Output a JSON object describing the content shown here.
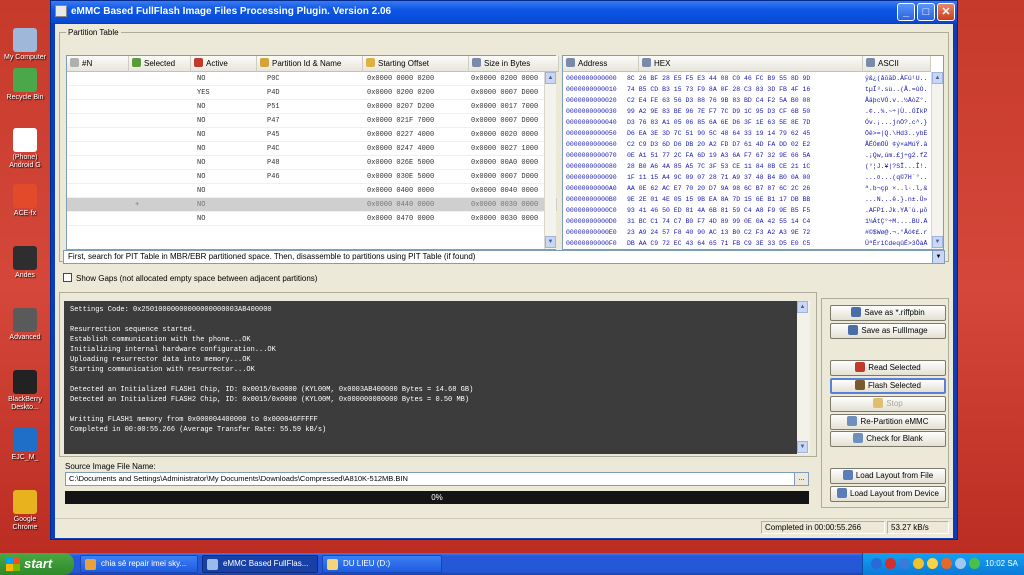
{
  "desktop": {
    "icons": [
      {
        "label": "My Computer",
        "color": "#9fb7d9"
      },
      {
        "label": "Recycle Bin",
        "color": "#4aa84a"
      },
      {
        "label": "(Phone) Android G",
        "color": "#ffffff"
      },
      {
        "label": "ACE-fx",
        "color": "#e24a2a"
      },
      {
        "label": "Andes",
        "color": "#2e2e2e"
      },
      {
        "label": "Advanced",
        "color": "#5a5a5a"
      },
      {
        "label": "BlackBerry Deskto...",
        "color": "#222222"
      },
      {
        "label": "EJC_M_",
        "color": "#1f6fc9"
      },
      {
        "label": "Google Chrome",
        "color": "#e8b21f"
      }
    ]
  },
  "window": {
    "title": "eMMC Based FullFlash Image Files Processing Plugin. Version 2.06",
    "minimize": "_",
    "maximize": "□",
    "close": "✕"
  },
  "partition_table": {
    "label": "Partition Table",
    "columns": [
      "#N",
      "Selected",
      "Active",
      "Partition Id & Name",
      "Starting Offset",
      "Size in Bytes"
    ],
    "rows": [
      {
        "n": "",
        "selected": "",
        "active": "NO",
        "name": "P0C",
        "offset": "0x0000 0000 0200",
        "size": "0x0000 0200 0000"
      },
      {
        "n": "",
        "selected": "",
        "active": "YES",
        "name": "P4D",
        "offset": "0x0000 0200 0200",
        "size": "0x0000 0007 D000"
      },
      {
        "n": "",
        "selected": "",
        "active": "NO",
        "name": "P51",
        "offset": "0x0000 0207 D200",
        "size": "0x0000 0017 7000"
      },
      {
        "n": "",
        "selected": "",
        "active": "NO",
        "name": "P47",
        "offset": "0x0000 021F 7000",
        "size": "0x0000 0007 D000"
      },
      {
        "n": "",
        "selected": "",
        "active": "NO",
        "name": "P45",
        "offset": "0x0000 0227 4000",
        "size": "0x0000 0020 0000"
      },
      {
        "n": "",
        "selected": "",
        "active": "NO",
        "name": "P4C",
        "offset": "0x0000 0247 4000",
        "size": "0x0000 0027 1000"
      },
      {
        "n": "",
        "selected": "",
        "active": "NO",
        "name": "P48",
        "offset": "0x0000 026E 5000",
        "size": "0x0000 00A0 0000"
      },
      {
        "n": "",
        "selected": "",
        "active": "NO",
        "name": "P46",
        "offset": "0x0000 030E 5000",
        "size": "0x0000 0007 D000"
      },
      {
        "n": "",
        "selected": "",
        "active": "NO",
        "name": "",
        "offset": "0x0000 0400 0000",
        "size": "0x0000 0040 0000"
      },
      {
        "n": "",
        "selected": "+",
        "active": "NO",
        "name": "",
        "offset": "0x0000 0440 0000",
        "size": "0x0000 0030 0000"
      },
      {
        "n": "",
        "selected": "",
        "active": "NO",
        "name": "",
        "offset": "0x0000 0470 0000",
        "size": "0x0000 0030 0000"
      }
    ],
    "selected_index": 9
  },
  "hex_view": {
    "columns": [
      "Address",
      "HEX",
      "ASCII"
    ],
    "rows": [
      {
        "addr": "0000000000000",
        "hex": "8C 26 BF 28 E5 F5 E3 44 08 C0 46 FC B9 55 8D 9D",
        "ascii": "ÿ&¿(åõãD.ÀFü¹U.."
      },
      {
        "addr": "0000000000010",
        "hex": "74 B5 CD B3 15 73 F9 8A 0F 28 C3 83 3D FB 4F 16",
        "ascii": "tµÍ³.sù..(Ã.=ûO."
      },
      {
        "addr": "0000000000020",
        "hex": "C2 E4 FE 63 56 D3 88 76 9B 83 BD C4 F2 5A B0 08",
        "ascii": "ÂäþcVÓ.v..½ÄòZ°."
      },
      {
        "addr": "0000000000030",
        "hex": "99 A2 9E 83 BE 96 7E F7 7C D9 1C 95 D3 CF 6B 50",
        "ascii": ".¢..¾.~÷|Ù..ÓÏkP"
      },
      {
        "addr": "0000000000040",
        "hex": "D3 76 83 A1 05 06 85 6A 6E D6 3F 1E 63 5E 8E 7D",
        "ascii": "Óv.¡...jnÖ?.c^.}"
      },
      {
        "addr": "0000000000050",
        "hex": "D6 EA 3E 3D 7C 51 90 5C 48 64 33 19 14 79 62 45",
        "ascii": "Öê>=|Q.\\Hd3..ybE"
      },
      {
        "addr": "0000000000060",
        "hex": "C2 C9 D3 6D D6 DB 20 A2 FD D7 61 4D FA DD 02 E2",
        "ascii": "ÂÉÓmÖÛ ¢ý×aMúÝ.â"
      },
      {
        "addr": "0000000000070",
        "hex": "0E A1 51 77 2C FA 6D 19 A3 6A F7 67 32 9E 66 5A",
        "ascii": ".¡Qw,úm.£j÷g2.fZ"
      },
      {
        "addr": "0000000000080",
        "hex": "28 B0 A6 4A 85 A5 7C 3F 53 CE 11 84 8B CE 21 1C",
        "ascii": "(°¦J.¥|?SÎ...Î!."
      },
      {
        "addr": "0000000000090",
        "hex": "1F 11 15 A4 9C 09 07 28 71 A9 37 48 B4 B0 0A 00",
        "ascii": "...¤...(q©7H´°.."
      },
      {
        "addr": "00000000000A0",
        "hex": "AA 0E 62 AC E7 70 20 D7 9A 98 6C B7 87 6C 2C 26",
        "ascii": "ª.b¬çp ×..l·.l,&"
      },
      {
        "addr": "00000000000B0",
        "hex": "9E 2E 01 4E 05 15 9B EA 8A 7D 15 6E B1 17 DB BB",
        "ascii": "...N...ê.}.n±.Û»"
      },
      {
        "addr": "00000000000C0",
        "hex": "93 41 46 50 ED 81 4A 6B 81 59 C4 A8 F9 9E B5 F5",
        "ascii": ".AFPí.Jk.YÄ¨ù.µõ"
      },
      {
        "addr": "00000000000D0",
        "hex": "31 BC C1 74 C7 B0 F7 4D 89 99 0E 0A 42 55 14 C4",
        "ascii": "1¼ÁtÇ°÷M....BU.Ä"
      },
      {
        "addr": "00000000000E0",
        "hex": "23 A9 24 57 F8 40 90 AC 13 B0 C2 F3 A2 A3 9E 72",
        "ascii": "#©$Wø@.¬.°Âó¢£.r"
      },
      {
        "addr": "00000000000F0",
        "hex": "DB AA C9 72 EC 43 64 65 71 FB C9 3E 33 D5 E0 C5",
        "ascii": "ÛªÉrìCdeqûÉ>3ÕàÅ"
      }
    ]
  },
  "pit_mode": "First, search for PIT Table in MBR/EBR partitioned space. Then, disassemble to partitions using PIT Table (if found)",
  "show_gaps_label": "Show Gaps (not allocated empty space between adjacent partitions)",
  "log_lines": [
    "Settings Code: 0x25010000000000000000003AB400000",
    "",
    "Resurrection sequence started.",
    "Establish communication with the phone...OK",
    "Initializing internal hardware configuration...OK",
    "Uploading resurrector data into memory...OK",
    "Starting communication with resurrector...OK",
    "",
    "Detected an Initialized FLASH1 Chip, ID: 0x0015/0x0000 (KYL00M, 0x0003AB400000 Bytes = 14.68 GB)",
    "Detected an Initialized FLASH2 Chip, ID: 0x0015/0x0000 (KYL00M, 0x000000080000 Bytes = 0.50 MB)",
    "",
    "Writting FLASH1 memory from 0x000004400000 to 0x000046FFFFF",
    "Completed in 00:00:55.266 (Average Transfer Rate: 55.59 kB/s)"
  ],
  "buttons": {
    "save_riff": "Save as *.riffpbin",
    "save_full": "Save as FullImage",
    "read_selected": "Read Selected",
    "flash_selected": "Flash Selected",
    "stop": "Stop",
    "repartition": "Re-Partition eMMC",
    "check_blank": "Check for Blank",
    "load_file": "Load Layout from File",
    "load_device": "Load Layout from Device"
  },
  "source": {
    "label": "Source Image File Name:",
    "path": "C:\\Documents and Settings\\Administrator\\My Documents\\Downloads\\Compressed\\A810K-512MB.BIN",
    "browse": "..."
  },
  "progress": {
    "text": "0%",
    "value": 0
  },
  "status": {
    "completed": "Completed in 00:00:55.266",
    "rate": "53.27 kB/s"
  },
  "taskbar": {
    "start": "start",
    "tasks": [
      {
        "label": "chia sẻ repair imei sky...",
        "color": "#e9a23b"
      },
      {
        "label": "eMMC Based FullFlas...",
        "color": "#9bb9e9"
      },
      {
        "label": "DU LIEU (D:)",
        "color": "#f4d57a"
      }
    ],
    "clock": "10:02 SA"
  }
}
